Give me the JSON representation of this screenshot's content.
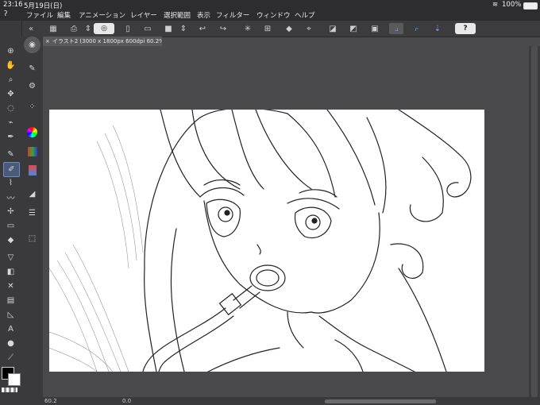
{
  "status": {
    "time": "23:16",
    "date": "5月19日(日)",
    "battery": "100%"
  },
  "menu": [
    "ファイル",
    "編集",
    "アニメーション",
    "レイヤー",
    "選択範囲",
    "表示",
    "フィルター",
    "ウィンドウ",
    "ヘルプ"
  ],
  "toolbar": {
    "help_label": "?"
  },
  "document": {
    "tab_title": "イラスト2 (3000 x 1800px 600dpi 60.2%)"
  },
  "statusbar": {
    "zoom": "60.2",
    "angle": "0.0"
  },
  "colors": {
    "main": "#000000",
    "sub": "#ffffff",
    "accent": "#6fa8ff",
    "background": "#4a4a4c"
  },
  "icons": {
    "toolbar": [
      "grid-icon",
      "export-icon",
      "transparency-toggle-icon",
      "new-file-icon",
      "open-folder-icon",
      "save-icon",
      "undo-icon",
      "redo-icon",
      "clear-icon",
      "crop-icon",
      "fill-icon",
      "transform-icon",
      "ruler-icon",
      "snap-ruler-icon",
      "snap-grid-icon",
      "snap-special-icon",
      "help-icon"
    ],
    "tools": [
      "zoom-icon",
      "hand-icon",
      "magnifier-icon",
      "move-icon",
      "lasso-icon",
      "eyedropper-icon",
      "pen-icon",
      "pencil-icon",
      "brush-icon",
      "airbrush-icon",
      "blend-icon",
      "eraser-icon",
      "fill-icon",
      "gradient-icon",
      "figure-icon",
      "frame-icon",
      "text-icon",
      "balloon-icon",
      "line-correction-icon"
    ],
    "palettes": [
      "sub-tool-icon",
      "tool-property-icon",
      "brush-size-icon",
      "color-wheel-icon",
      "color-set-icon",
      "intermediate-color-icon",
      "approx-color-icon",
      "color-history-icon",
      "layer-property-icon",
      "layer-icon",
      "material-icon"
    ]
  }
}
